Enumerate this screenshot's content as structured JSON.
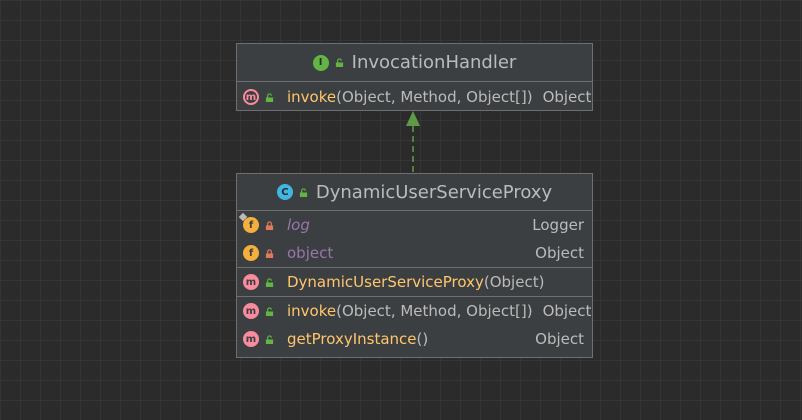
{
  "colors": {
    "background": "#2b2b2b",
    "node_fill": "#3c3f41",
    "node_border": "#6f6f6f",
    "method_name": "#ffc66d",
    "field_name": "#9876aa",
    "text": "#bbbbbb",
    "edge": "#5f9b47"
  },
  "interface_node": {
    "kind_icon": "interface-icon",
    "kind_letter": "I",
    "title": "InvocationHandler",
    "methods": [
      {
        "icon": "abstract-method-icon",
        "letter": "m",
        "access": "public",
        "name": "invoke",
        "params": "(Object, Method, Object[])",
        "type": "Object"
      }
    ]
  },
  "class_node": {
    "kind_icon": "class-icon",
    "kind_letter": "C",
    "title": "DynamicUserServiceProxy",
    "fields": [
      {
        "icon": "static-field-icon",
        "letter": "f",
        "access": "private",
        "name": "log",
        "type": "Logger"
      },
      {
        "icon": "field-icon",
        "letter": "f",
        "access": "private",
        "name": "object",
        "type": "Object"
      }
    ],
    "constructors": [
      {
        "icon": "method-icon",
        "letter": "m",
        "access": "public",
        "name": "DynamicUserServiceProxy",
        "params": "(Object)",
        "type": ""
      }
    ],
    "methods": [
      {
        "icon": "method-icon",
        "letter": "m",
        "access": "public",
        "name": "invoke",
        "params": "(Object, Method, Object[])",
        "type": "Object"
      },
      {
        "icon": "method-icon",
        "letter": "m",
        "access": "public",
        "name": "getProxyInstance",
        "params": "()",
        "type": "Object"
      }
    ]
  },
  "relation": {
    "type": "implements",
    "from": "DynamicUserServiceProxy",
    "to": "InvocationHandler"
  }
}
